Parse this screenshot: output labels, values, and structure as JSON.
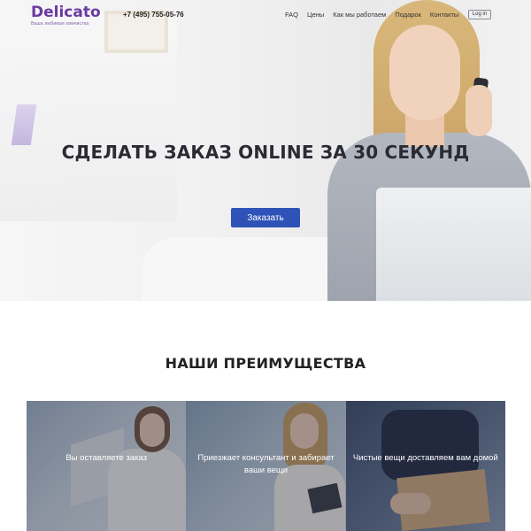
{
  "header": {
    "logo_text": "Delicato",
    "logo_tagline": "Ваша любимая химчистка",
    "phone": "+7 (495) 755-05-76",
    "nav": [
      "FAQ",
      "Цены",
      "Как мы работаем",
      "Подарок",
      "Контакты"
    ],
    "login_label": "Log in"
  },
  "hero": {
    "title": "СДЕЛАТЬ ЗАКАЗ ONLINE ЗА 30 СЕКУНД",
    "order_button": "Заказать"
  },
  "advantages": {
    "title": "НАШИ ПРЕИМУЩЕСТВА",
    "cards": [
      "Вы оставляете заказ",
      "Приезжает консультант и забирает ваши вещи",
      "Чистые вещи доставляем вам домой"
    ]
  },
  "colors": {
    "brand_purple": "#6b3aa1",
    "button_blue": "#2e52b8"
  }
}
